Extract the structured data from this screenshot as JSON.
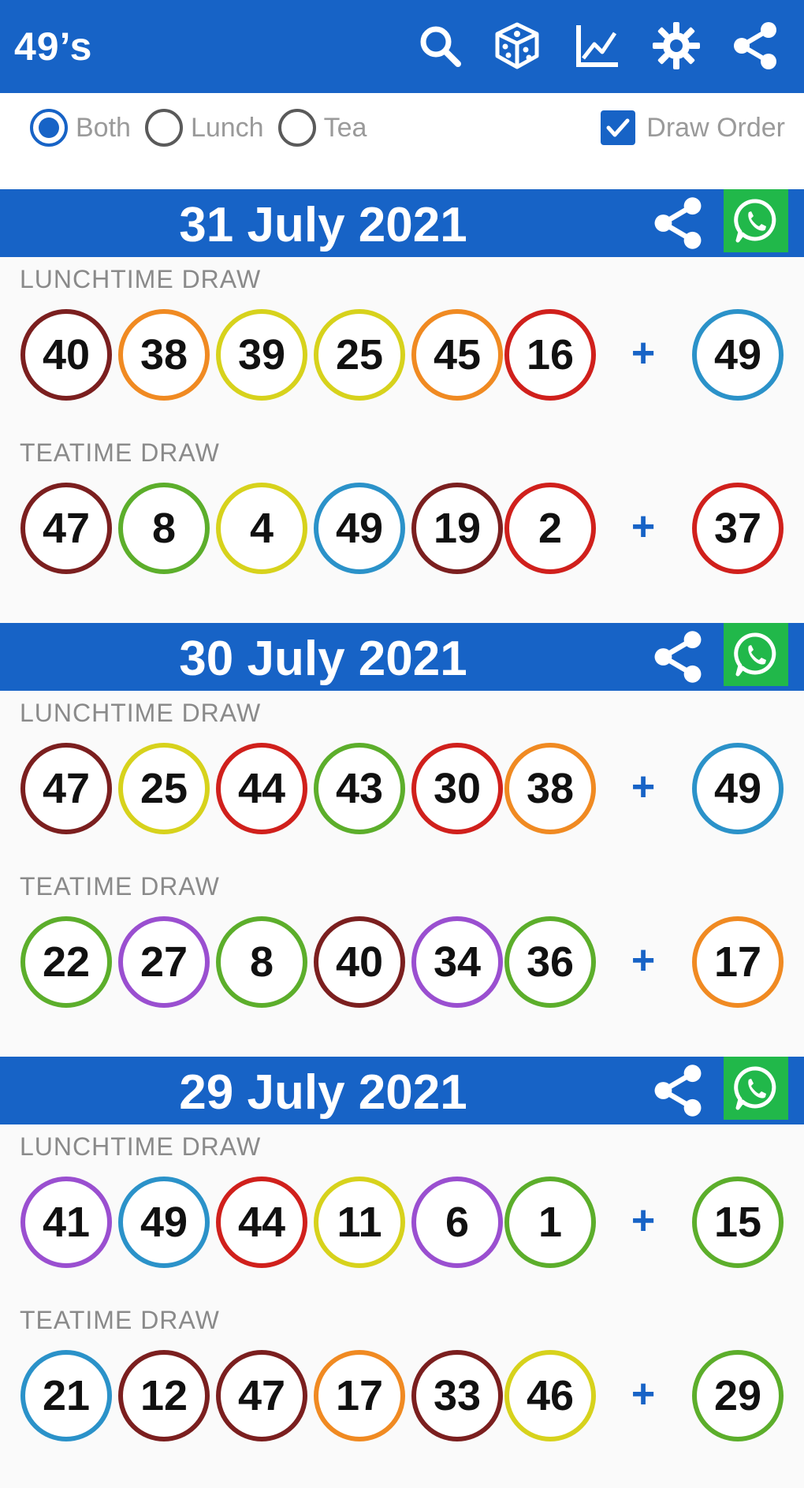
{
  "app": {
    "title": "49’s"
  },
  "toolbar": {
    "icons": [
      "search-icon",
      "dice-icon",
      "chart-icon",
      "gear-icon",
      "share-icon"
    ]
  },
  "filters": {
    "radios": [
      {
        "label": "Both",
        "selected": true
      },
      {
        "label": "Lunch",
        "selected": false
      },
      {
        "label": "Tea",
        "selected": false
      }
    ],
    "checkbox": {
      "label": "Draw Order",
      "checked": true
    }
  },
  "colors": {
    "accent": "#1763c6",
    "whatsapp": "#21b84a",
    "ball_brown": "#7b1f1f",
    "ball_orange": "#f08a22",
    "ball_yellow": "#d7d21c",
    "ball_red": "#d0201c",
    "ball_blue": "#2b92c9",
    "ball_green": "#5cae2b",
    "ball_purple": "#9a4fd0"
  },
  "days": [
    {
      "date": "31 July 2021",
      "draws": [
        {
          "label": "LUNCHTIME DRAW",
          "balls": [
            {
              "n": "40",
              "c": "brown"
            },
            {
              "n": "38",
              "c": "orange"
            },
            {
              "n": "39",
              "c": "yellow"
            },
            {
              "n": "25",
              "c": "yellow"
            },
            {
              "n": "45",
              "c": "orange"
            },
            {
              "n": "16",
              "c": "red"
            }
          ],
          "plus": "+",
          "bonus": {
            "n": "49",
            "c": "blue"
          }
        },
        {
          "label": "TEATIME DRAW",
          "balls": [
            {
              "n": "47",
              "c": "brown"
            },
            {
              "n": "8",
              "c": "green"
            },
            {
              "n": "4",
              "c": "yellow"
            },
            {
              "n": "49",
              "c": "blue"
            },
            {
              "n": "19",
              "c": "brown"
            },
            {
              "n": "2",
              "c": "red"
            }
          ],
          "plus": "+",
          "bonus": {
            "n": "37",
            "c": "red"
          }
        }
      ]
    },
    {
      "date": "30 July 2021",
      "draws": [
        {
          "label": "LUNCHTIME DRAW",
          "balls": [
            {
              "n": "47",
              "c": "brown"
            },
            {
              "n": "25",
              "c": "yellow"
            },
            {
              "n": "44",
              "c": "red"
            },
            {
              "n": "43",
              "c": "green"
            },
            {
              "n": "30",
              "c": "red"
            },
            {
              "n": "38",
              "c": "orange"
            }
          ],
          "plus": "+",
          "bonus": {
            "n": "49",
            "c": "blue"
          }
        },
        {
          "label": "TEATIME DRAW",
          "balls": [
            {
              "n": "22",
              "c": "green"
            },
            {
              "n": "27",
              "c": "purple"
            },
            {
              "n": "8",
              "c": "green"
            },
            {
              "n": "40",
              "c": "brown"
            },
            {
              "n": "34",
              "c": "purple"
            },
            {
              "n": "36",
              "c": "green"
            }
          ],
          "plus": "+",
          "bonus": {
            "n": "17",
            "c": "orange"
          }
        }
      ]
    },
    {
      "date": "29 July 2021",
      "draws": [
        {
          "label": "LUNCHTIME DRAW",
          "balls": [
            {
              "n": "41",
              "c": "purple"
            },
            {
              "n": "49",
              "c": "blue"
            },
            {
              "n": "44",
              "c": "red"
            },
            {
              "n": "11",
              "c": "yellow"
            },
            {
              "n": "6",
              "c": "purple"
            },
            {
              "n": "1",
              "c": "green"
            }
          ],
          "plus": "+",
          "bonus": {
            "n": "15",
            "c": "green"
          }
        },
        {
          "label": "TEATIME DRAW",
          "balls": [
            {
              "n": "21",
              "c": "blue"
            },
            {
              "n": "12",
              "c": "brown"
            },
            {
              "n": "47",
              "c": "brown"
            },
            {
              "n": "17",
              "c": "orange"
            },
            {
              "n": "33",
              "c": "brown"
            },
            {
              "n": "46",
              "c": "yellow"
            }
          ],
          "plus": "+",
          "bonus": {
            "n": "29",
            "c": "green"
          }
        }
      ]
    }
  ]
}
